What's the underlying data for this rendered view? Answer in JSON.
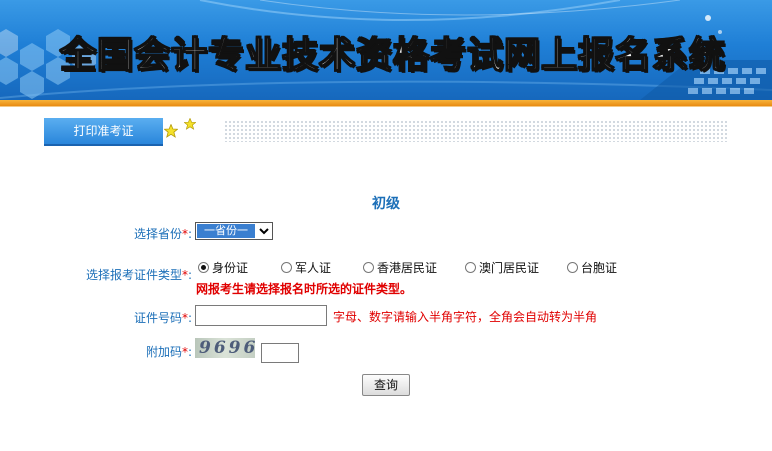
{
  "header": {
    "title": "全国会计专业技术资格考试网上报名系统"
  },
  "tabs": [
    {
      "label": "打印准考证"
    }
  ],
  "form": {
    "level": "初级",
    "province": {
      "label": "选择省份",
      "required_mark": "*",
      "colon": ":",
      "selected": "一省份一"
    },
    "id_type": {
      "label": "选择报考证件类型",
      "required_mark": "*",
      "colon": ":",
      "options": [
        {
          "label": "身份证",
          "checked": true
        },
        {
          "label": "军人证",
          "checked": false
        },
        {
          "label": "香港居民证",
          "checked": false
        },
        {
          "label": "澳门居民证",
          "checked": false
        },
        {
          "label": "台胞证",
          "checked": false
        }
      ],
      "warning": "网报考生请选择报名时所选的证件类型。"
    },
    "id_number": {
      "label": "证件号码",
      "required_mark": "*",
      "colon": ":",
      "value": "",
      "hint": "字母、数字请输入半角字符，全角会自动转为半角"
    },
    "captcha": {
      "label": "附加码",
      "required_mark": "*",
      "colon": ":",
      "code": "9696",
      "value": ""
    },
    "submit_label": "查询"
  },
  "colors": {
    "accent_blue": "#1c6fb8",
    "required_red": "#e00000",
    "banner_orange": "#e88b12"
  }
}
